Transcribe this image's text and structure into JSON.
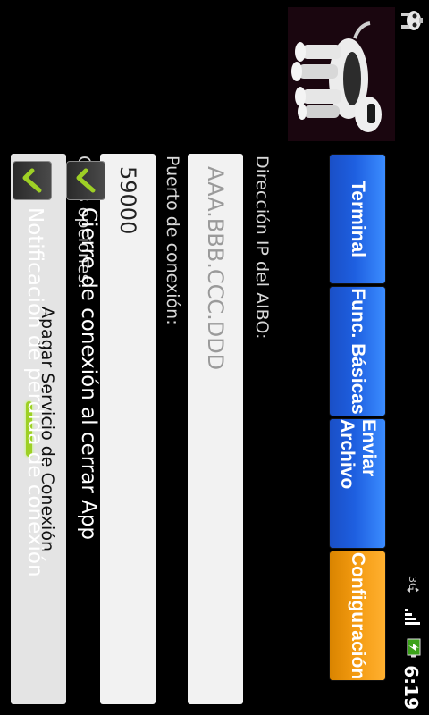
{
  "status_bar": {
    "time": "6:19",
    "network_label": "3G",
    "icons": [
      "aibo-robot-icon",
      "3g-data-icon",
      "signal-strength-icon",
      "battery-charging-icon"
    ]
  },
  "tabs": [
    {
      "label": "Terminal",
      "active": false,
      "color": "#2a6fe8"
    },
    {
      "label": "Func. Básicas",
      "active": false,
      "color": "#2a6fe8"
    },
    {
      "label": "Enviar Archivo",
      "active": false,
      "color": "#2a6fe8"
    },
    {
      "label": "Configuración",
      "active": true,
      "color": "#f5a01a"
    }
  ],
  "form": {
    "ip_label": "Dirección IP del AIBO:",
    "ip_placeholder": "AAA.BBB.CCC.DDD",
    "port_label": "Puerto de conexión:",
    "port_value": "59000",
    "other_options_label": "Otras opciones:",
    "service_button_label": "Apagar Servicio de Conexión",
    "service_led_color": "#9ed025"
  },
  "options": [
    {
      "label": "Cierre de conexión al cerrar App",
      "checked": true
    },
    {
      "label": "Notificación de pérdida de conexión",
      "checked": true
    }
  ]
}
